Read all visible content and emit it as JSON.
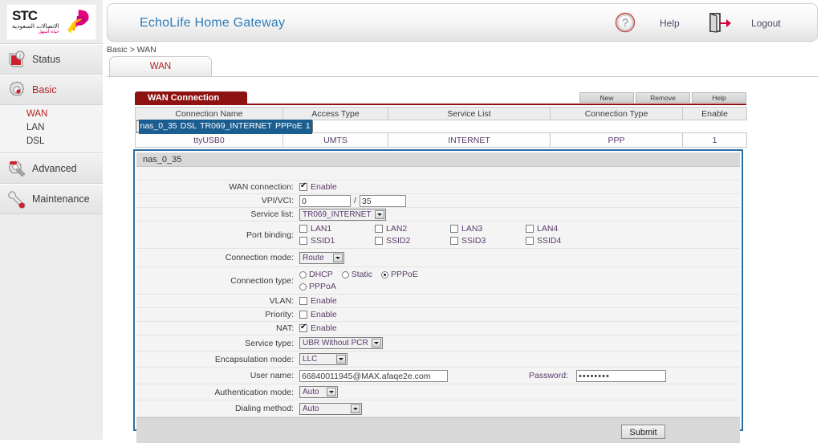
{
  "logo": {
    "brand": "STC",
    "arabic_line1": "الاتصالات السعودية",
    "arabic_line2": "حياة أسهل",
    "icon": "stc-swoosh-logo"
  },
  "header": {
    "title": "EchoLife Home Gateway",
    "help_label": "Help",
    "help_icon": "question-mark-circle-icon",
    "logout_label": "Logout",
    "logout_icon": "exit-door-arrow-icon",
    "title_color": "#2d7cb8"
  },
  "sidebar": {
    "groups": [
      {
        "label": "Status",
        "icon": "info-document-icon",
        "active": false,
        "children": []
      },
      {
        "label": "Basic",
        "icon": "gear-icon",
        "active": true,
        "children": [
          {
            "label": "WAN",
            "active": true
          },
          {
            "label": "LAN",
            "active": false
          },
          {
            "label": "DSL",
            "active": false
          }
        ]
      },
      {
        "label": "Advanced",
        "icon": "gear-tools-icon",
        "active": false,
        "children": []
      },
      {
        "label": "Maintenance",
        "icon": "wrench-icon",
        "active": false,
        "children": []
      }
    ]
  },
  "breadcrumb": "Basic > WAN",
  "tabs": [
    {
      "label": "WAN",
      "active": true
    }
  ],
  "wan_table": {
    "panel_title": "WAN Connection",
    "panel_title_bg": "#8f1212",
    "buttons": [
      {
        "label": "New",
        "name": "new-button"
      },
      {
        "label": "Remove",
        "name": "remove-button"
      },
      {
        "label": "Help",
        "name": "help-button"
      }
    ],
    "columns": [
      "Connection Name",
      "Access Type",
      "Service List",
      "Connection Type",
      "Enable"
    ],
    "rows": [
      {
        "selected": true,
        "cells": [
          "nas_0_35",
          "DSL",
          "TR069_INTERNET",
          "PPPoE",
          "1"
        ]
      },
      {
        "selected": false,
        "cells": [
          "ttyUSB0",
          "UMTS",
          "INTERNET",
          "PPP",
          "1"
        ]
      }
    ],
    "selected_row_bg": "#1a5d90"
  },
  "form": {
    "header": "nas_0_35",
    "wan_connection": {
      "label": "WAN connection:",
      "checkbox_label": "Enable",
      "checked": true
    },
    "vpi_vci": {
      "label": "VPI/VCI:",
      "vpi": "0",
      "separator": "/",
      "vci": "35"
    },
    "service_list": {
      "label": "Service list:",
      "value": "TR069_INTERNET"
    },
    "port_binding": {
      "label": "Port binding:",
      "items": [
        {
          "label": "LAN1",
          "checked": false
        },
        {
          "label": "LAN2",
          "checked": false
        },
        {
          "label": "LAN3",
          "checked": false
        },
        {
          "label": "LAN4",
          "checked": false
        },
        {
          "label": "SSID1",
          "checked": false
        },
        {
          "label": "SSID2",
          "checked": false
        },
        {
          "label": "SSID3",
          "checked": false
        },
        {
          "label": "SSID4",
          "checked": false
        }
      ]
    },
    "connection_mode": {
      "label": "Connection mode:",
      "value": "Route"
    },
    "connection_type": {
      "label": "Connection type:",
      "options": [
        {
          "label": "DHCP",
          "selected": false
        },
        {
          "label": "Static",
          "selected": false
        },
        {
          "label": "PPPoE",
          "selected": true
        },
        {
          "label": "PPPoA",
          "selected": false
        }
      ]
    },
    "vlan": {
      "label": "VLAN:",
      "checkbox_label": "Enable",
      "checked": false
    },
    "priority": {
      "label": "Priority:",
      "checkbox_label": "Enable",
      "checked": false
    },
    "nat": {
      "label": "NAT:",
      "checkbox_label": "Enable",
      "checked": true
    },
    "service_type": {
      "label": "Service type:",
      "value": "UBR Without PCR"
    },
    "encapsulation_mode": {
      "label": "Encapsulation mode:",
      "value": "LLC"
    },
    "user_name": {
      "label": "User name:",
      "value": "66840011945@MAX.afaqe2e.com"
    },
    "password": {
      "label": "Password:",
      "value": "••••••••"
    },
    "authentication_mode": {
      "label": "Authentication mode:",
      "value": "Auto"
    },
    "dialing_method": {
      "label": "Dialing method:",
      "value": "Auto"
    },
    "submit_label": "Submit",
    "border_color": "#2a6ea5"
  }
}
